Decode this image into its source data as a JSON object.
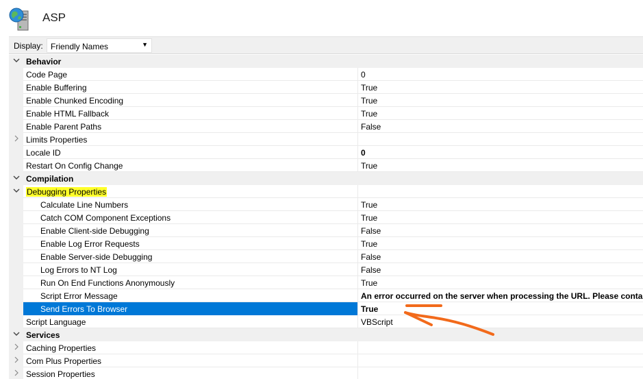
{
  "header": {
    "title": "ASP",
    "icon": "globe-server-icon"
  },
  "toolbar": {
    "display_label": "Display:",
    "display_value": "Friendly Names"
  },
  "colors": {
    "selection": "#0078d7",
    "highlight": "#ffff2a",
    "annotation_arrow": "#f26a1b"
  },
  "rows": [
    {
      "kind": "category",
      "label": "Behavior",
      "toggle": "expanded"
    },
    {
      "kind": "prop",
      "label": "Code Page",
      "value": "0"
    },
    {
      "kind": "prop",
      "label": "Enable Buffering",
      "value": "True"
    },
    {
      "kind": "prop",
      "label": "Enable Chunked Encoding",
      "value": "True"
    },
    {
      "kind": "prop",
      "label": "Enable HTML Fallback",
      "value": "True"
    },
    {
      "kind": "prop",
      "label": "Enable Parent Paths",
      "value": "False"
    },
    {
      "kind": "prop",
      "label": "Limits Properties",
      "value": "",
      "toggle": "collapsed"
    },
    {
      "kind": "prop",
      "label": "Locale ID",
      "value": "0",
      "bold": true
    },
    {
      "kind": "prop",
      "label": "Restart On Config Change",
      "value": "True"
    },
    {
      "kind": "category",
      "label": "Compilation",
      "toggle": "expanded"
    },
    {
      "kind": "prop",
      "label": "Debugging Properties",
      "value": "",
      "toggle": "expanded",
      "highlighted": true
    },
    {
      "kind": "prop",
      "indent": 2,
      "label": "Calculate Line Numbers",
      "value": "True"
    },
    {
      "kind": "prop",
      "indent": 2,
      "label": "Catch COM Component Exceptions",
      "value": "True"
    },
    {
      "kind": "prop",
      "indent": 2,
      "label": "Enable Client-side Debugging",
      "value": "False"
    },
    {
      "kind": "prop",
      "indent": 2,
      "label": "Enable Log Error Requests",
      "value": "True"
    },
    {
      "kind": "prop",
      "indent": 2,
      "label": "Enable Server-side Debugging",
      "value": "False"
    },
    {
      "kind": "prop",
      "indent": 2,
      "label": "Log Errors to NT Log",
      "value": "False"
    },
    {
      "kind": "prop",
      "indent": 2,
      "label": "Run On End Functions Anonymously",
      "value": "True"
    },
    {
      "kind": "prop",
      "indent": 2,
      "label": "Script Error Message",
      "value": "An error occurred on the server when processing the URL. Please contact",
      "bold": true
    },
    {
      "kind": "prop",
      "indent": 2,
      "label": "Send Errors To Browser",
      "value": "True",
      "bold": true,
      "selected": true
    },
    {
      "kind": "prop",
      "label": "Script Language",
      "value": "VBScript"
    },
    {
      "kind": "category",
      "label": "Services",
      "toggle": "expanded"
    },
    {
      "kind": "prop",
      "label": "Caching Properties",
      "value": "",
      "toggle": "collapsed"
    },
    {
      "kind": "prop",
      "label": "Com Plus Properties",
      "value": "",
      "toggle": "collapsed"
    },
    {
      "kind": "prop",
      "label": "Session Properties",
      "value": "",
      "toggle": "collapsed"
    }
  ]
}
